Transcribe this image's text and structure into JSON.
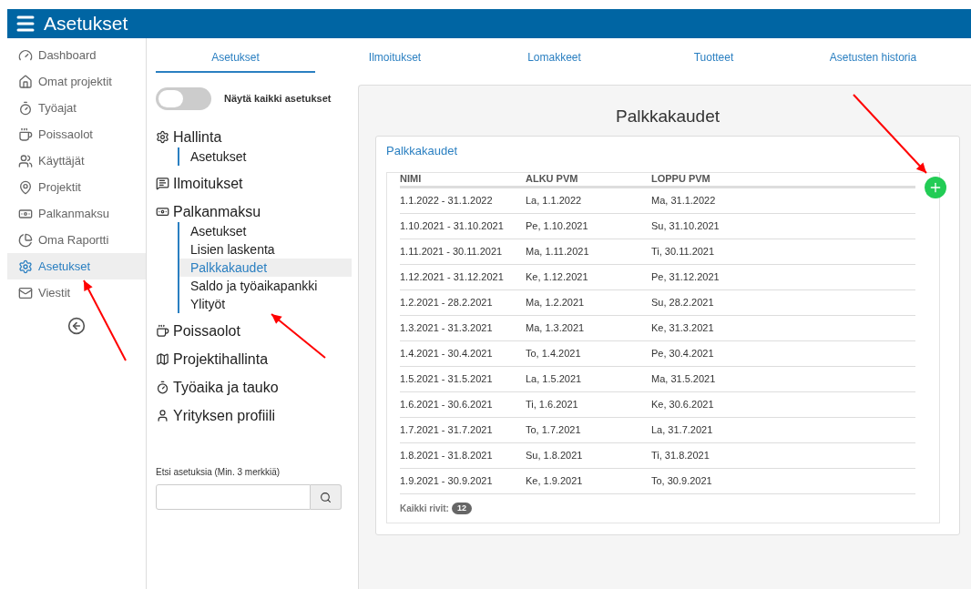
{
  "topbar": {
    "title": "Asetukset"
  },
  "sidebar": {
    "items": [
      {
        "label": "Dashboard",
        "selected": false
      },
      {
        "label": "Omat projektit",
        "selected": false
      },
      {
        "label": "Työajat",
        "selected": false
      },
      {
        "label": "Poissaolot",
        "selected": false
      },
      {
        "label": "Käyttäjät",
        "selected": false
      },
      {
        "label": "Projektit",
        "selected": false
      },
      {
        "label": "Palkanmaksu",
        "selected": false
      },
      {
        "label": "Oma Raportti",
        "selected": false
      },
      {
        "label": "Asetukset",
        "selected": true
      },
      {
        "label": "Viestit",
        "selected": false
      }
    ]
  },
  "tabs": [
    {
      "label": "Asetukset",
      "selected": true
    },
    {
      "label": "Ilmoitukset",
      "selected": false
    },
    {
      "label": "Lomakkeet",
      "selected": false
    },
    {
      "label": "Tuotteet",
      "selected": false
    },
    {
      "label": "Asetusten historia",
      "selected": false
    }
  ],
  "toggle": {
    "label": "Näytä kaikki asetukset",
    "on": false
  },
  "settings_tree": [
    {
      "label": "Hallinta",
      "children": [
        {
          "label": "Asetukset",
          "selected": false
        }
      ]
    },
    {
      "label": "Ilmoitukset"
    },
    {
      "label": "Palkanmaksu",
      "children": [
        {
          "label": "Asetukset",
          "selected": false
        },
        {
          "label": "Lisien laskenta",
          "selected": false
        },
        {
          "label": "Palkkakaudet",
          "selected": true
        },
        {
          "label": "Saldo ja työaikapankki",
          "selected": false
        },
        {
          "label": "Ylityöt",
          "selected": false
        }
      ]
    },
    {
      "label": "Poissaolot"
    },
    {
      "label": "Projektihallinta"
    },
    {
      "label": "Työaika ja tauko"
    },
    {
      "label": "Yrityksen profiili"
    }
  ],
  "search": {
    "label": "Etsi asetuksia (Min. 3 merkkiä)"
  },
  "panel": {
    "title": "Palkkakaudet",
    "card_title": "Palkkakaudet",
    "table": {
      "columns": [
        "NIMI",
        "ALKU PVM",
        "LOPPU PVM"
      ],
      "rows": [
        [
          "1.1.2022 - 31.1.2022",
          "La, 1.1.2022",
          "Ma, 31.1.2022"
        ],
        [
          "1.10.2021 - 31.10.2021",
          "Pe, 1.10.2021",
          "Su, 31.10.2021"
        ],
        [
          "1.11.2021 - 30.11.2021",
          "Ma, 1.11.2021",
          "Ti, 30.11.2021"
        ],
        [
          "1.12.2021 - 31.12.2021",
          "Ke, 1.12.2021",
          "Pe, 31.12.2021"
        ],
        [
          "1.2.2021 - 28.2.2021",
          "Ma, 1.2.2021",
          "Su, 28.2.2021"
        ],
        [
          "1.3.2021 - 31.3.2021",
          "Ma, 1.3.2021",
          "Ke, 31.3.2021"
        ],
        [
          "1.4.2021 - 30.4.2021",
          "To, 1.4.2021",
          "Pe, 30.4.2021"
        ],
        [
          "1.5.2021 - 31.5.2021",
          "La, 1.5.2021",
          "Ma, 31.5.2021"
        ],
        [
          "1.6.2021 - 30.6.2021",
          "Ti, 1.6.2021",
          "Ke, 30.6.2021"
        ],
        [
          "1.7.2021 - 31.7.2021",
          "To, 1.7.2021",
          "La, 31.7.2021"
        ],
        [
          "1.8.2021 - 31.8.2021",
          "Su, 1.8.2021",
          "Ti, 31.8.2021"
        ],
        [
          "1.9.2021 - 30.9.2021",
          "Ke, 1.9.2021",
          "To, 30.9.2021"
        ]
      ],
      "footer_label": "Kaikki rivit:",
      "count": "12"
    }
  }
}
